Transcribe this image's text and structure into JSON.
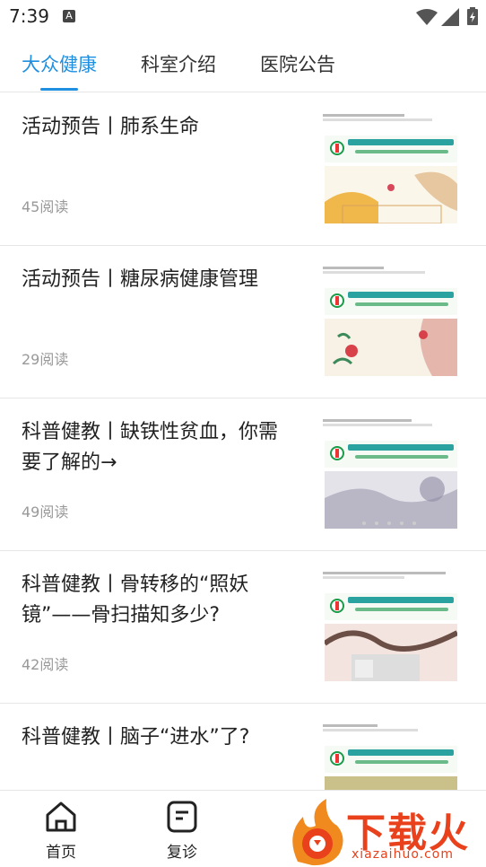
{
  "status": {
    "time": "7:39",
    "notif": "A"
  },
  "tabs": [
    "大众健康",
    "科室介绍",
    "医院公告"
  ],
  "articles": [
    {
      "title": "活动预告丨肺系生命",
      "reads": "45阅读"
    },
    {
      "title": "活动预告丨糖尿病健康管理",
      "reads": "29阅读"
    },
    {
      "title": "科普健教丨缺铁性贫血，你需要了解的→",
      "reads": "49阅读"
    },
    {
      "title": "科普健教丨骨转移的“照妖镜”——骨扫描知多少?",
      "reads": "42阅读"
    },
    {
      "title": "科普健教丨脑子“进水”了?",
      "reads": ""
    }
  ],
  "bottom_nav": [
    {
      "label": "首页",
      "icon": "home-icon"
    },
    {
      "label": "复诊",
      "icon": "note-icon"
    }
  ],
  "watermark": {
    "text": "下载火",
    "sub": "xiazaihuo.com"
  },
  "colors": {
    "accent": "#1e8fe1",
    "watermark": "#e8411c"
  }
}
